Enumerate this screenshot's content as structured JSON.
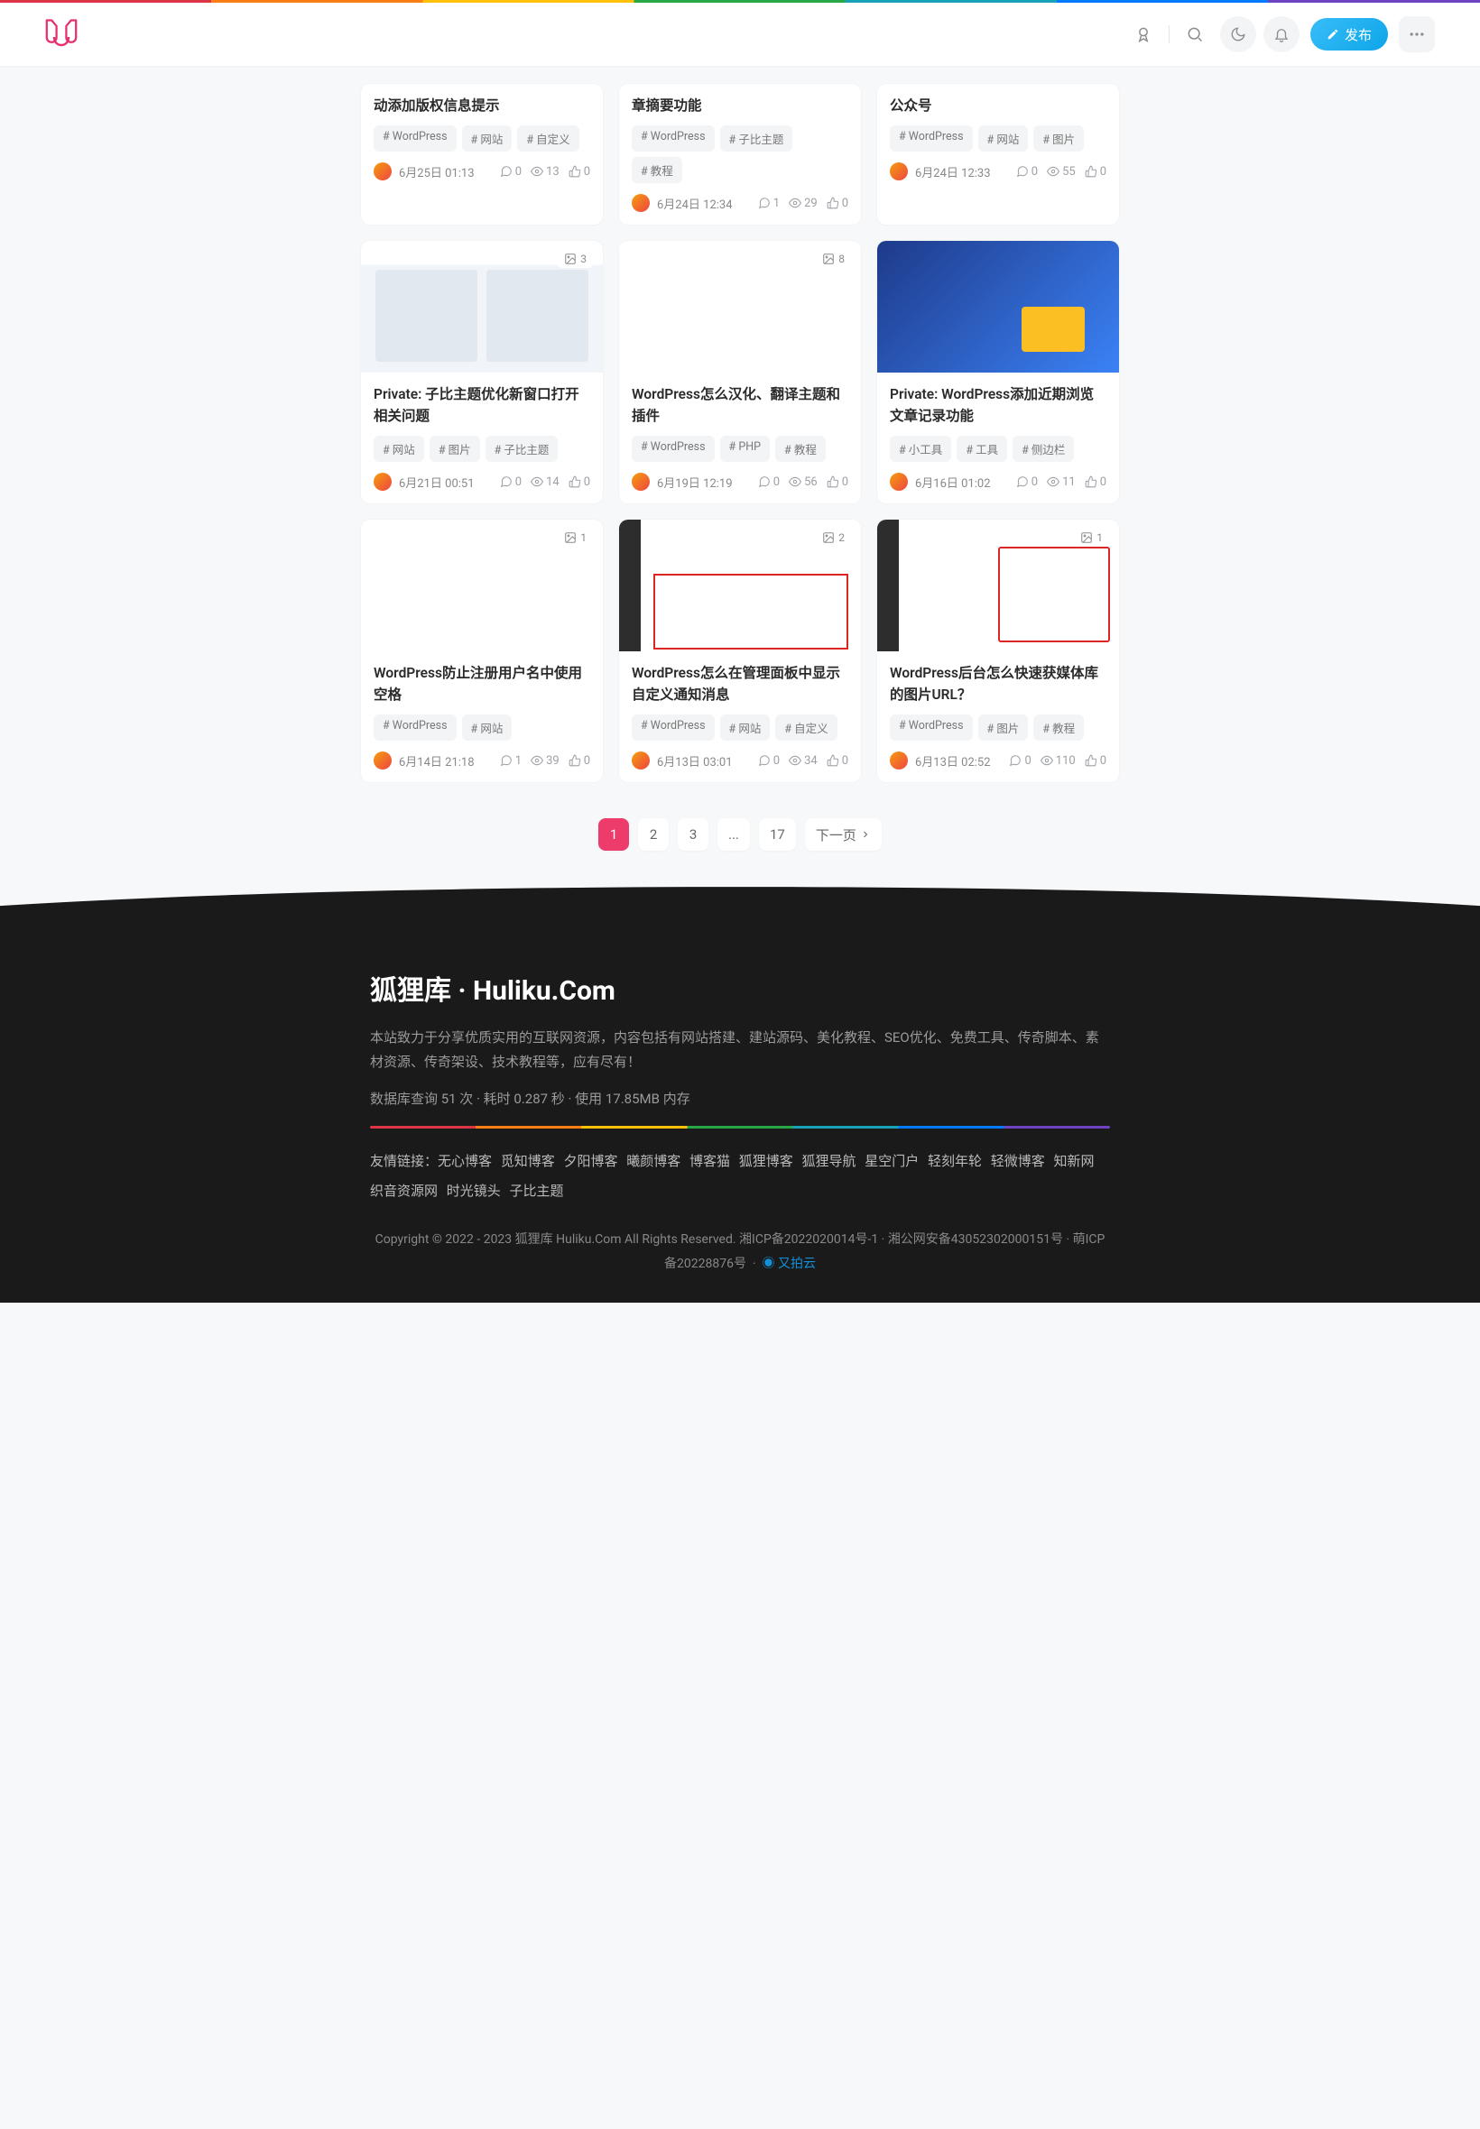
{
  "header": {
    "publish_label": "发布"
  },
  "cards": [
    {
      "title": "动添加版权信息提示",
      "tags": [
        "WordPress",
        "网站",
        "自定义"
      ],
      "date": "6月25日 01:13",
      "comments": "0",
      "views": "13",
      "likes": "0",
      "badge": "",
      "partial": true
    },
    {
      "title": "章摘要功能",
      "tags": [
        "WordPress",
        "子比主题",
        "教程"
      ],
      "date": "6月24日 12:34",
      "comments": "1",
      "views": "29",
      "likes": "0",
      "badge": "",
      "partial": true
    },
    {
      "title": "公众号",
      "tags": [
        "WordPress",
        "网站",
        "图片"
      ],
      "date": "6月24日 12:33",
      "comments": "0",
      "views": "55",
      "likes": "0",
      "badge": "",
      "partial": true
    },
    {
      "title": "Private: 子比主题优化新窗口打开相关问题",
      "tags": [
        "网站",
        "图片",
        "子比主题"
      ],
      "date": "6月21日 00:51",
      "comments": "0",
      "views": "14",
      "likes": "0",
      "badge": "3",
      "thumb": "tm1"
    },
    {
      "title": "WordPress怎么汉化、翻译主题和插件",
      "tags": [
        "WordPress",
        "PHP",
        "教程"
      ],
      "date": "6月19日 12:19",
      "comments": "0",
      "views": "56",
      "likes": "0",
      "badge": "8",
      "thumb": "tm2"
    },
    {
      "title": "Private: WordPress添加近期浏览文章记录功能",
      "tags": [
        "小工具",
        "工具",
        "侧边栏"
      ],
      "date": "6月16日 01:02",
      "comments": "0",
      "views": "11",
      "likes": "0",
      "badge": "",
      "thumb": "tm3"
    },
    {
      "title": "WordPress防止注册用户名中使用空格",
      "tags": [
        "WordPress",
        "网站"
      ],
      "date": "6月14日 21:18",
      "comments": "1",
      "views": "39",
      "likes": "0",
      "badge": "1",
      "thumb": "tm4"
    },
    {
      "title": "WordPress怎么在管理面板中显示自定义通知消息",
      "tags": [
        "WordPress",
        "网站",
        "自定义"
      ],
      "date": "6月13日 03:01",
      "comments": "0",
      "views": "34",
      "likes": "0",
      "badge": "2",
      "thumb": "tm5"
    },
    {
      "title": "WordPress后台怎么快速获媒体库的图片URL？",
      "tags": [
        "WordPress",
        "图片",
        "教程"
      ],
      "date": "6月13日 02:52",
      "comments": "0",
      "views": "110",
      "likes": "0",
      "badge": "1",
      "thumb": "tm6"
    }
  ],
  "pager": {
    "pages": [
      "1",
      "2",
      "3",
      "...",
      "17"
    ],
    "next": "下一页"
  },
  "footer": {
    "title": "狐狸库 · Huliku.Com",
    "desc": "本站致力于分享优质实用的互联网资源，内容包括有网站搭建、建站源码、美化教程、SEO优化、免费工具、传奇脚本、素材资源、传奇架设、技术教程等，应有尽有！",
    "stat": "数据库查询 51 次 · 耗时 0.287 秒 · 使用 17.85MB 内存",
    "links_label": "友情链接：",
    "links": [
      "无心博客",
      "觅知博客",
      "夕阳博客",
      "曦颜博客",
      "博客猫",
      "狐狸博客",
      "狐狸导航",
      "星空门户",
      "轻刻年轮",
      "轻微博客",
      "知新网",
      "织音资源网",
      "时光镜头",
      "子比主题"
    ],
    "copyright_prefix": "Copyright © 2022 - 2023 狐狸库 Huliku.Com All Rights Reserved. ",
    "icp1": "湘ICP备2022020014号-1",
    "icp2": "湘公网安备43052302000151号",
    "icp3": "萌ICP备20228876号",
    "upyun": "又拍云"
  }
}
